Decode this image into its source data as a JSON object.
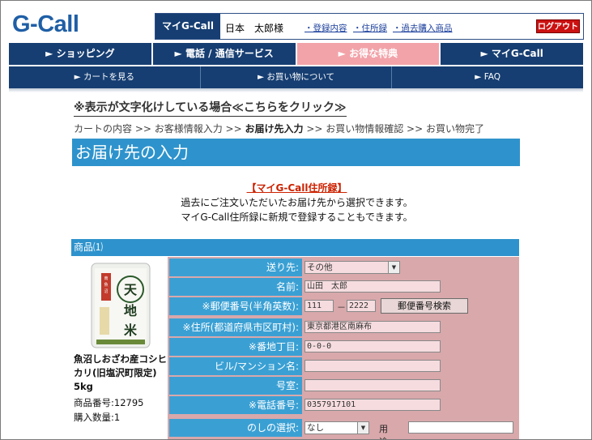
{
  "header": {
    "logo": "G-Call",
    "my_label": "マイG-Call",
    "user_name": "日本　太郎様",
    "links": [
      "・登録内容",
      "・住所録",
      "・過去購入商品"
    ],
    "logout": "ログアウト"
  },
  "nav_main": [
    "► ショッピング",
    "► 電話 / 通信サービス",
    "► お得な特典",
    "► マイG-Call"
  ],
  "nav_sub": [
    "► カートを見る",
    "► お買い物について",
    "► FAQ"
  ],
  "notice": "※表示が文字化けしている場合≪こちらをクリック≫",
  "steps": {
    "before": "カートの内容 >> お客様情報入力 >> ",
    "current": "お届け先入力",
    "after": " >> お買い物情報確認 >> お買い物完了"
  },
  "page_title": "お届け先の入力",
  "address_book": {
    "link": "【マイG-Call住所録】",
    "note1": "過去にご注文いただいたお届け先から選択できます。",
    "note2": "マイG-Call住所録に新規で登録することもできます。"
  },
  "product": {
    "header": "商品⑴",
    "name": "魚沼しおざわ産コシヒカリ(旧塩沢町限定) 5kg",
    "number": "商品番号:12795",
    "quantity": "購入数量:1",
    "package_text": "天地米"
  },
  "form": {
    "destination": {
      "label": "送り先:",
      "value": "その他"
    },
    "name": {
      "label": "名前:",
      "value": "山田　太郎"
    },
    "zip": {
      "label": "※郵便番号(半角英数):",
      "value1": "111",
      "value2": "2222",
      "button": "郵便番号検索"
    },
    "address": {
      "label": "※住所(都道府県市区町村):",
      "value": "東京都港区南麻布"
    },
    "block": {
      "label": "※番地丁目:",
      "value": "0-0-0"
    },
    "building": {
      "label": "ビル/マンション名:",
      "value": ""
    },
    "room": {
      "label": "号室:",
      "value": ""
    },
    "phone": {
      "label": "※電話番号:",
      "value": "0357917101"
    },
    "noshi": {
      "label": "のしの選択:",
      "value": "なし",
      "usage_label": "用途:"
    }
  }
}
